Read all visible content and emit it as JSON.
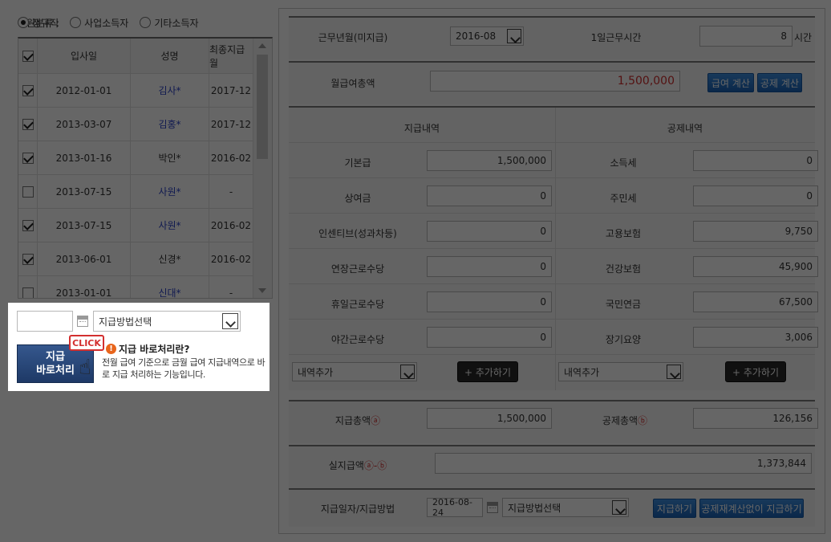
{
  "employee_filter": {
    "label": "직원분류 :",
    "options": [
      {
        "label": "정규직",
        "selected": true
      },
      {
        "label": "사업소득자",
        "selected": false
      },
      {
        "label": "기타소득자",
        "selected": false
      }
    ]
  },
  "employee_table": {
    "headers": [
      "입사일",
      "성명",
      "최종지급월"
    ],
    "rows": [
      {
        "checked": true,
        "hire_date": "2012-01-01",
        "name": "김사*",
        "name_link": true,
        "last_pay": "2017-12"
      },
      {
        "checked": true,
        "hire_date": "2013-03-07",
        "name": "김홍*",
        "name_link": true,
        "last_pay": "2017-12"
      },
      {
        "checked": true,
        "hire_date": "2013-01-16",
        "name": "박인*",
        "name_link": false,
        "last_pay": "2016-02"
      },
      {
        "checked": false,
        "hire_date": "2013-07-15",
        "name": "사원*",
        "name_link": true,
        "last_pay": "-"
      },
      {
        "checked": true,
        "hire_date": "2013-07-15",
        "name": "사원*",
        "name_link": true,
        "last_pay": "2016-02"
      },
      {
        "checked": true,
        "hire_date": "2013-06-01",
        "name": "신경*",
        "name_link": false,
        "last_pay": "2016-02"
      },
      {
        "checked": false,
        "hire_date": "2013-01-01",
        "name": "신대*",
        "name_link": true,
        "last_pay": "-"
      }
    ]
  },
  "quick_pay": {
    "date_value": "",
    "method_select": "지급방법선택",
    "button_line1": "지급",
    "button_line2": "바로처리",
    "click_badge": "CLICK",
    "info_icon": "!",
    "info_title": "지급 바로처리란?",
    "info_desc": "전월 급여 기준으로 금월 급여 지급내역으로 바로 지급 처리하는 기능입니다."
  },
  "work_period": {
    "label": "근무년월(미지급)",
    "value": "2016-08",
    "hours_label": "1일근무시간",
    "hours_value": "8",
    "hours_unit": "시간"
  },
  "monthly_total": {
    "label": "월급여총액",
    "value": "1,500,000",
    "calc_salary_btn": "급여 계산",
    "calc_deduct_btn": "공제 계산"
  },
  "pay_section": {
    "header": "지급내역"
  },
  "deduct_section": {
    "header": "공제내역"
  },
  "pay_items": [
    {
      "label": "기본급",
      "value": "1,500,000"
    },
    {
      "label": "상여금",
      "value": "0"
    },
    {
      "label": "인센티브(성과차등)",
      "value": "0"
    },
    {
      "label": "연장근로수당",
      "value": "0"
    },
    {
      "label": "휴일근로수당",
      "value": "0"
    },
    {
      "label": "야간근로수당",
      "value": "0"
    }
  ],
  "deduct_items": [
    {
      "label": "소득세",
      "value": "0"
    },
    {
      "label": "주민세",
      "value": "0"
    },
    {
      "label": "고용보험",
      "value": "9,750"
    },
    {
      "label": "건강보험",
      "value": "45,900"
    },
    {
      "label": "국민연금",
      "value": "67,500"
    },
    {
      "label": "장기요양",
      "value": "3,006"
    }
  ],
  "add_item": {
    "select_placeholder": "내역추가",
    "add_button": "+ 추가하기"
  },
  "totals": {
    "pay_label": "지급총액",
    "pay_mark": "ⓐ",
    "pay_value": "1,500,000",
    "deduct_label": "공제총액",
    "deduct_mark": "ⓑ",
    "deduct_value": "126,156"
  },
  "net": {
    "label": "실지급액",
    "mark": "ⓐ-ⓑ",
    "value": "1,373,844"
  },
  "payment": {
    "label": "지급일자/지급방법",
    "date": "2016-08-24",
    "method": "지급방법선택",
    "pay_button": "지급하기",
    "pay_no_recalc_button": "공제재계산없이 지급하기"
  },
  "colors": {
    "overlay": "#000000",
    "accent_blue": "#1a63b8",
    "value_red": "#d32f2f",
    "link_blue": "#2b43c9"
  }
}
